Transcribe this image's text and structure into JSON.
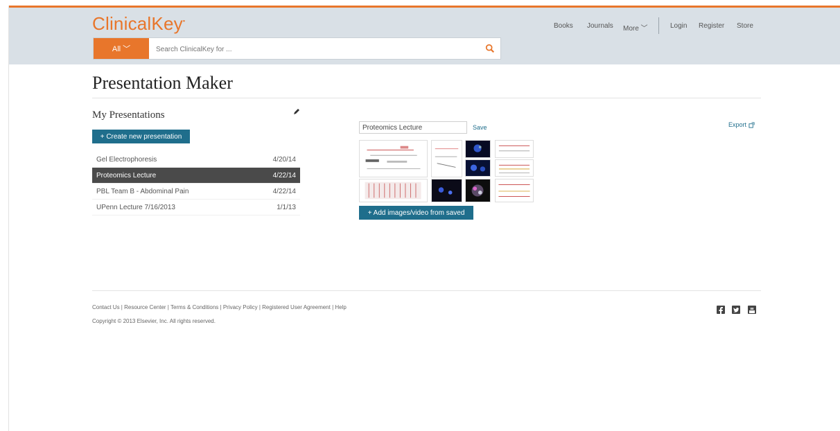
{
  "brand": {
    "logo": "ClinicalKey",
    "accent_color": "#e8762b",
    "primary_button_color": "#1f6e8c"
  },
  "search": {
    "scope_label": "All ﹀",
    "placeholder": "Search ClinicalKey for ...",
    "icon": "search-icon"
  },
  "nav": {
    "books": "Books",
    "journals": "Journals",
    "more": "More ﹀",
    "login": "Login",
    "register": "Register",
    "store": "Store"
  },
  "page": {
    "title": "Presentation Maker"
  },
  "my_presentations": {
    "heading": "My Presentations",
    "edit_icon": "pencil-icon",
    "create_label": "+ Create new presentation",
    "items": [
      {
        "name": "Gel Electrophoresis",
        "date": "4/20/14",
        "active": false
      },
      {
        "name": "Proteomics Lecture",
        "date": "4/22/14",
        "active": true
      },
      {
        "name": "PBL Team B - Abdominal Pain",
        "date": "4/22/14",
        "active": false
      },
      {
        "name": "UPenn Lecture 7/16/2013",
        "date": "1/1/13",
        "active": false
      }
    ]
  },
  "editor": {
    "name_value": "Proteomics Lecture",
    "save_label": "Save",
    "export_label": "Export",
    "export_icon": "external-link-icon",
    "add_media_label": "+ Add images/video from saved"
  },
  "footer": {
    "links": "Contact Us | Resource Center | Terms & Conditions | Privacy Policy | Registered User Agreement | Help",
    "copyright": "Copyright © 2013 Elsevier, Inc. All rights reserved.",
    "social_icons": [
      "facebook-icon",
      "twitter-icon",
      "youtube-icon"
    ]
  }
}
